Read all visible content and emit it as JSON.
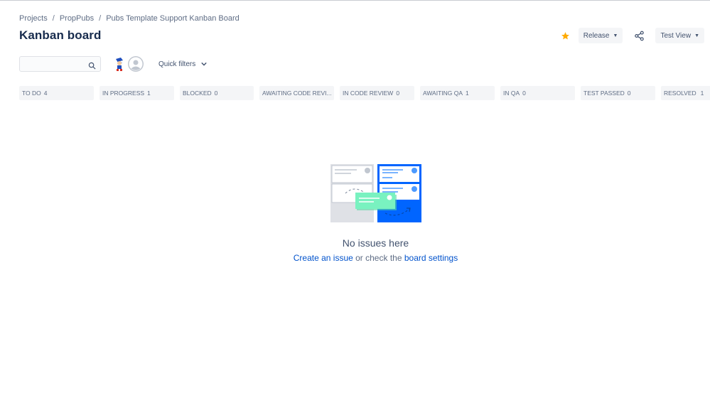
{
  "breadcrumb": {
    "items": [
      "Projects",
      "PropPubs",
      "Pubs Template Support Kanban Board"
    ],
    "separator": "/"
  },
  "page": {
    "title": "Kanban board"
  },
  "header_actions": {
    "star_icon": "star-icon",
    "release_label": "Release",
    "share_icon": "share-icon",
    "view_label": "Test View"
  },
  "toolbar": {
    "search_placeholder": "",
    "search_icon": "search-icon",
    "quick_filters_label": "Quick filters"
  },
  "columns": [
    {
      "name": "TO DO",
      "count": "4"
    },
    {
      "name": "IN PROGRESS",
      "count": "1"
    },
    {
      "name": "BLOCKED",
      "count": "0"
    },
    {
      "name": "AWAITING CODE REVI...",
      "count": "0"
    },
    {
      "name": "IN CODE REVIEW",
      "count": "0"
    },
    {
      "name": "AWAITING QA",
      "count": "1"
    },
    {
      "name": "IN QA",
      "count": "0"
    },
    {
      "name": "TEST PASSED",
      "count": "0"
    },
    {
      "name": "RESOLVED",
      "count": "1"
    }
  ],
  "empty_state": {
    "title": "No issues here",
    "create_link": "Create an issue",
    "middle_text": " or check the ",
    "settings_link": "board settings"
  },
  "colors": {
    "accent": "#0052cc",
    "star": "#ffab00",
    "column_bg": "#f4f5f7"
  }
}
